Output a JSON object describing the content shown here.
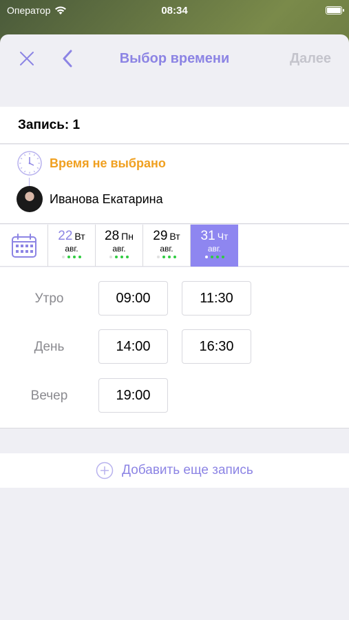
{
  "status_bar": {
    "carrier": "Оператор",
    "time": "08:34"
  },
  "nav": {
    "title": "Выбор времени",
    "next_label": "Далее"
  },
  "record": {
    "title": "Запись: 1"
  },
  "selection": {
    "time_status": "Время не выбрано",
    "master_name": "Иванова Екатарина"
  },
  "dates": [
    {
      "day": "22",
      "weekday": "Вт",
      "month": "авг.",
      "selected": false,
      "accent": true,
      "dots": [
        "#e0e0e0",
        "#2ecc40",
        "#2ecc40",
        "#2ecc40"
      ]
    },
    {
      "day": "28",
      "weekday": "Пн",
      "month": "авг.",
      "selected": false,
      "accent": false,
      "dots": [
        "#e0e0e0",
        "#2ecc40",
        "#2ecc40",
        "#2ecc40"
      ]
    },
    {
      "day": "29",
      "weekday": "Вт",
      "month": "авг.",
      "selected": false,
      "accent": false,
      "dots": [
        "#e0e0e0",
        "#2ecc40",
        "#2ecc40",
        "#2ecc40"
      ]
    },
    {
      "day": "31",
      "weekday": "Чт",
      "month": "авг.",
      "selected": true,
      "accent": false,
      "dots": [
        "#ffffff",
        "#2ecc40",
        "#2ecc40",
        "#2ecc40"
      ]
    }
  ],
  "slots": {
    "morning_label": "Утро",
    "morning": [
      "09:00",
      "11:30"
    ],
    "day_label": "День",
    "day": [
      "14:00",
      "16:30"
    ],
    "evening_label": "Вечер",
    "evening": [
      "19:00"
    ]
  },
  "add_record_label": "Добавить еще запись",
  "colors": {
    "accent": "#8c84e4",
    "warning": "#f0a020",
    "selected_bg": "#8e86f0",
    "available_dot": "#2ecc40"
  }
}
